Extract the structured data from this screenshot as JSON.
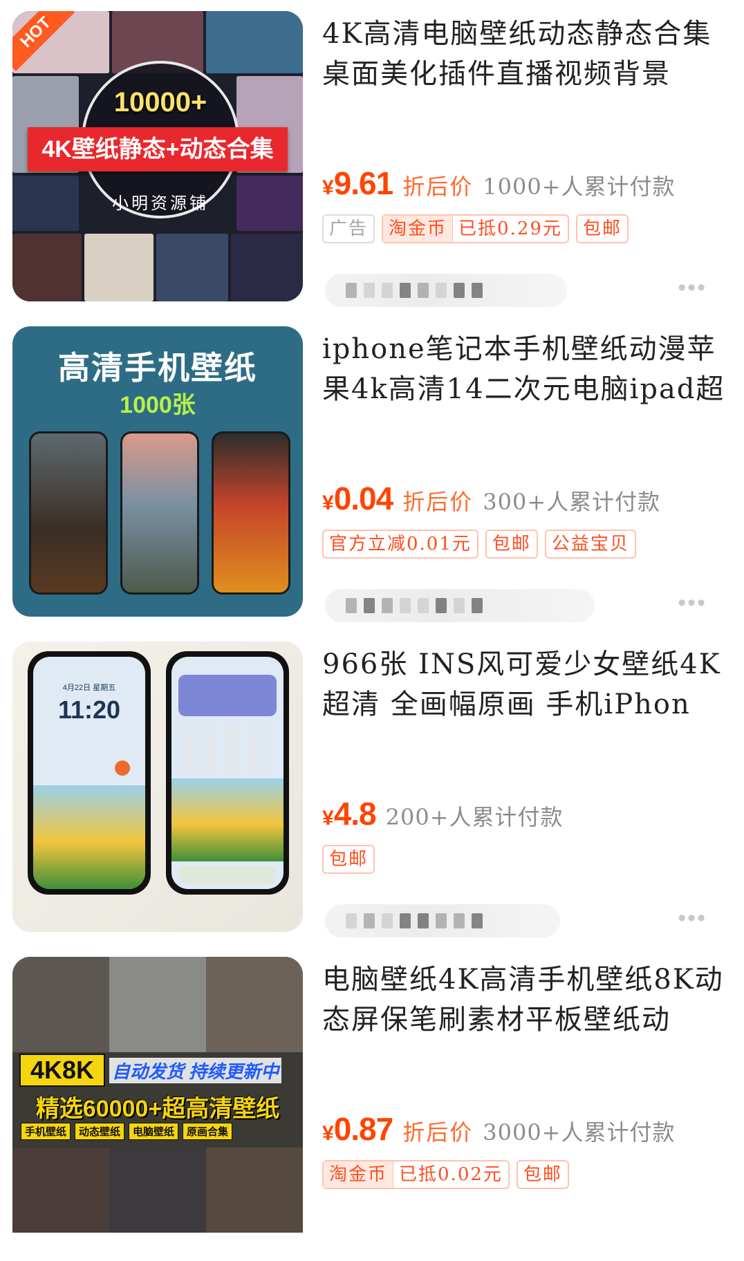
{
  "products": [
    {
      "title": "4K高清电脑壁纸动态静态合集桌面美化插件直播视频背景",
      "price_currency": "¥",
      "price_value": "9.61",
      "discount_label": "折后价",
      "paid_count": "1000+人累计付款",
      "tags": {
        "ad": "广告",
        "coin": "淘金币",
        "coin_off": "已抵0.29元",
        "shipping": "包邮"
      },
      "thumb": {
        "hot": "HOT",
        "count": "10000+",
        "banner": "4K壁纸静态+动态合集",
        "shop": "小明资源铺"
      }
    },
    {
      "title": "iphone笔记本手机壁纸动漫苹果4k高清14二次元电脑ipad超",
      "price_currency": "¥",
      "price_value": "0.04",
      "discount_label": "折后价",
      "paid_count": "300+人累计付款",
      "tags": {
        "official": "官方立减0.01元",
        "shipping": "包邮",
        "charity": "公益宝贝"
      },
      "thumb": {
        "heading": "高清手机壁纸",
        "sub": "1000张"
      }
    },
    {
      "title": "966张 INS风可爱少女壁纸4K超清 全画幅原画 手机iPhon",
      "price_currency": "¥",
      "price_value": "4.8",
      "paid_count": "200+人累计付款",
      "tags": {
        "shipping": "包邮"
      },
      "thumb": {
        "date": "4月22日 星期五",
        "time": "11:20"
      }
    },
    {
      "title": "电脑壁纸4K高清手机壁纸8K动态屏保笔刷素材平板壁纸动",
      "price_currency": "¥",
      "price_value": "0.87",
      "discount_label": "折后价",
      "paid_count": "3000+人累计付款",
      "tags": {
        "coin": "淘金币",
        "coin_off": "已抵0.02元",
        "shipping": "包邮"
      },
      "thumb": {
        "badge": "4K8K",
        "auto": "自动发货 持续更新中",
        "main": "精选60000+超高清壁纸",
        "chips": [
          "手机壁纸",
          "动态壁纸",
          "电脑壁纸",
          "原画合集"
        ]
      }
    }
  ],
  "colors": {
    "price": "#ff4400",
    "discount": "#ff6a2a",
    "paid": "#8c8c8c",
    "tag_border": "#ffc3ad"
  },
  "icons": {
    "more": "more-dots-icon"
  }
}
